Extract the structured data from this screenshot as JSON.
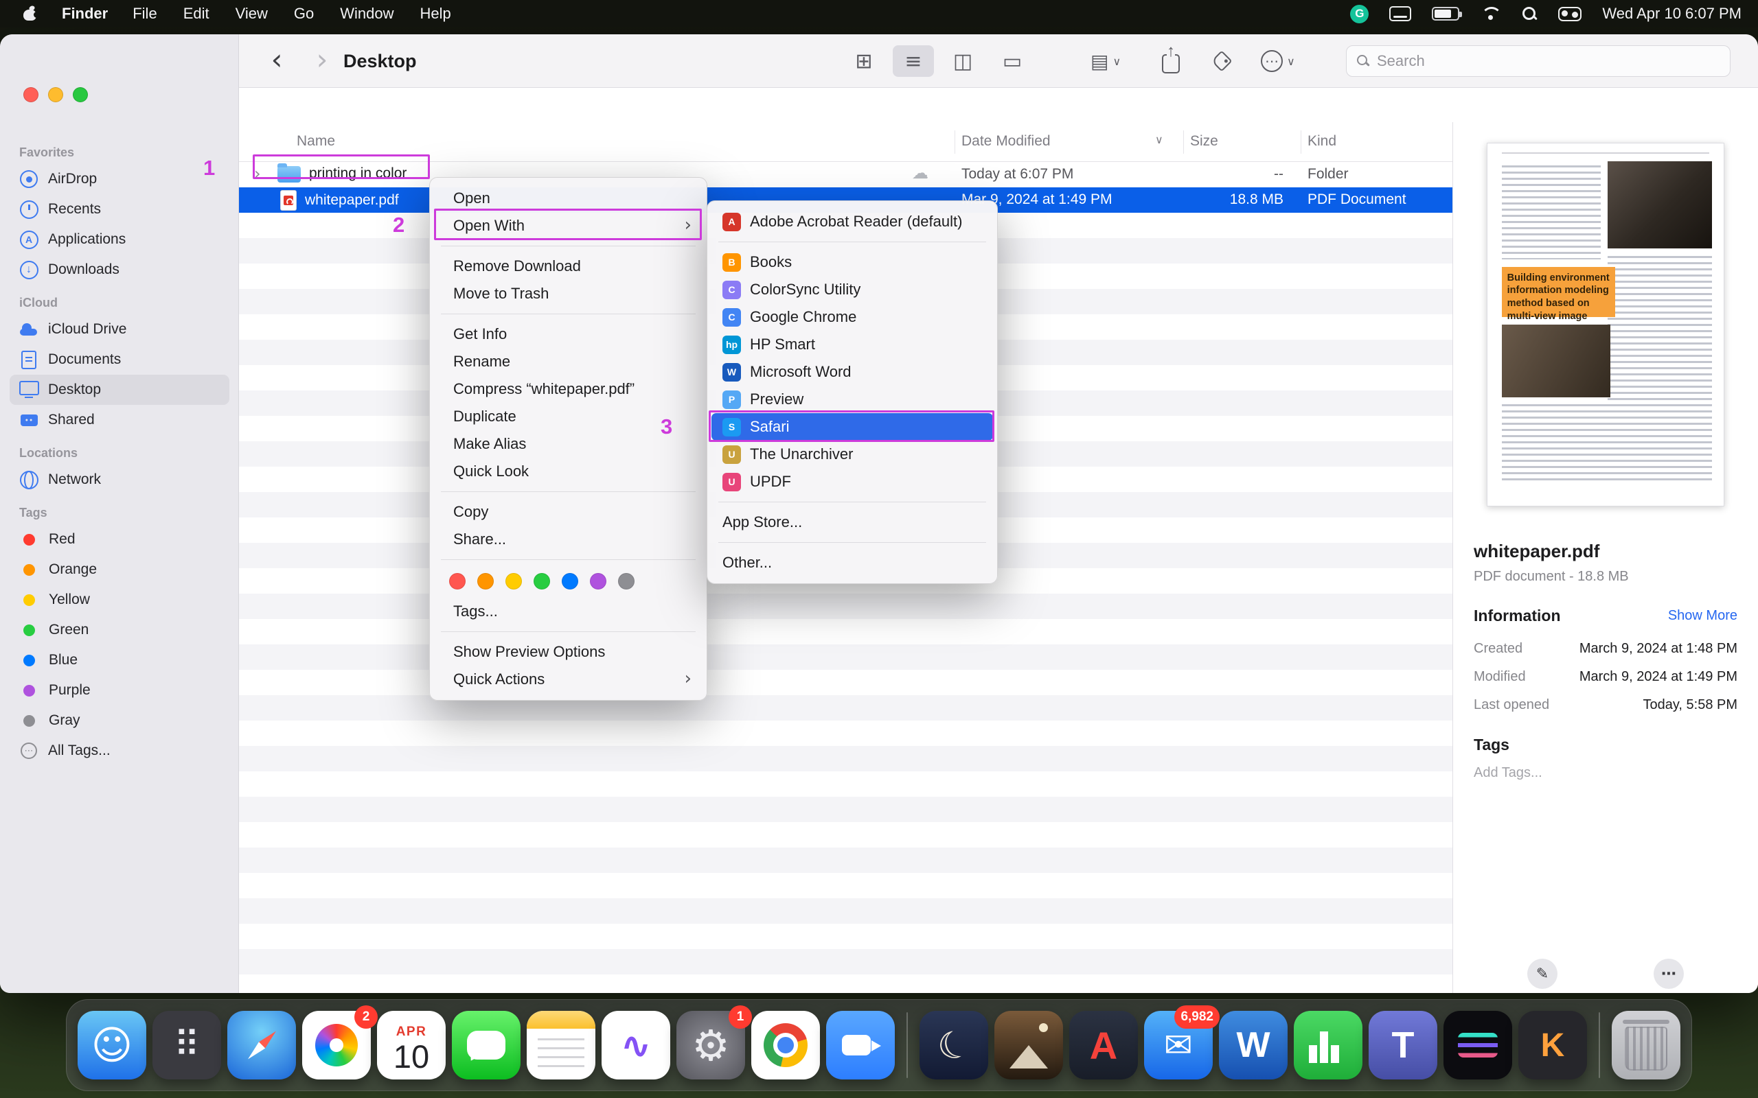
{
  "menu_bar": {
    "app_name": "Finder",
    "menus": [
      "File",
      "Edit",
      "View",
      "Go",
      "Window",
      "Help"
    ],
    "status": {
      "datetime": "Wed Apr 10  6:07 PM",
      "grammarly_glyph": "G"
    }
  },
  "toolbar": {
    "title": "Desktop",
    "search_placeholder": "Search"
  },
  "sidebar": {
    "favorites": {
      "title": "Favorites",
      "items": [
        {
          "label": "AirDrop",
          "icon": "airdrop-icon"
        },
        {
          "label": "Recents",
          "icon": "recents-icon"
        },
        {
          "label": "Applications",
          "icon": "applications-icon"
        },
        {
          "label": "Downloads",
          "icon": "downloads-icon"
        }
      ]
    },
    "icloud": {
      "title": "iCloud",
      "items": [
        {
          "label": "iCloud Drive",
          "icon": "icloud-drive-icon"
        },
        {
          "label": "Documents",
          "icon": "documents-icon"
        },
        {
          "label": "Desktop",
          "icon": "desktop-icon",
          "state": "selected"
        },
        {
          "label": "Shared",
          "icon": "shared-icon"
        }
      ]
    },
    "locations": {
      "title": "Locations",
      "items": [
        {
          "label": "Network",
          "icon": "network-icon"
        }
      ]
    },
    "tags": {
      "title": "Tags",
      "items": [
        {
          "label": "Red",
          "icon": "tag-dot",
          "color": "#ff3b30"
        },
        {
          "label": "Orange",
          "icon": "tag-dot",
          "color": "#ff9500"
        },
        {
          "label": "Yellow",
          "icon": "tag-dot",
          "color": "#ffcc00"
        },
        {
          "label": "Green",
          "icon": "tag-dot",
          "color": "#28cd41"
        },
        {
          "label": "Blue",
          "icon": "tag-dot",
          "color": "#007aff"
        },
        {
          "label": "Purple",
          "icon": "tag-dot",
          "color": "#af52de"
        },
        {
          "label": "Gray",
          "icon": "tag-dot",
          "color": "#8e8e93"
        },
        {
          "label": "All Tags...",
          "icon": "all-tags-icon"
        }
      ]
    }
  },
  "file_list": {
    "columns": [
      "Name",
      "Date Modified",
      "Size",
      "Kind"
    ],
    "rows": [
      {
        "name": "printing in color",
        "date_modified": "Today at 6:07 PM",
        "size": "--",
        "kind": "Folder",
        "icon": "folder-icon",
        "expandable": true,
        "has_cloud": true
      },
      {
        "name": "whitepaper.pdf",
        "date_modified": "Mar 9, 2024 at 1:49 PM",
        "size": "18.8 MB",
        "kind": "PDF Document",
        "icon": "pdf-icon",
        "state": "selected",
        "annotated": true
      }
    ]
  },
  "context_menu": {
    "group1": [
      {
        "label": "Open"
      },
      {
        "label": "Open With",
        "has_submenu": true,
        "annotated": true
      }
    ],
    "group2": [
      {
        "label": "Remove Download"
      },
      {
        "label": "Move to Trash"
      }
    ],
    "group3": [
      {
        "label": "Get Info"
      },
      {
        "label": "Rename"
      },
      {
        "label": "Compress “whitepaper.pdf”"
      },
      {
        "label": "Duplicate"
      },
      {
        "label": "Make Alias"
      },
      {
        "label": "Quick Look"
      }
    ],
    "group4": [
      {
        "label": "Copy"
      },
      {
        "label": "Share..."
      }
    ],
    "tag_colors": [
      {
        "name": "red-tag-dot",
        "color": "#ff564f"
      },
      {
        "name": "orange-tag-dot",
        "color": "#ff9500"
      },
      {
        "name": "yellow-tag-dot",
        "color": "#ffcc00"
      },
      {
        "name": "green-tag-dot",
        "color": "#28cd41"
      },
      {
        "name": "blue-tag-dot",
        "color": "#007aff"
      },
      {
        "name": "purple-tag-dot",
        "color": "#af52de"
      },
      {
        "name": "gray-tag-dot",
        "color": "#8e8e93"
      }
    ],
    "tags_item": "Tags...",
    "group5": [
      {
        "label": "Show Preview Options"
      },
      {
        "label": "Quick Actions",
        "has_submenu": true
      }
    ]
  },
  "open_with_submenu": {
    "group1": [
      {
        "label": "Adobe Acrobat Reader (default)",
        "icon_name": "acrobat-icon",
        "icon_color": "#d6362a",
        "icon_glyph": "A"
      }
    ],
    "group2": [
      {
        "label": "Books",
        "icon_name": "books-icon",
        "icon_color": "#ff9500",
        "icon_glyph": "B"
      },
      {
        "label": "ColorSync Utility",
        "icon_name": "colorsync-icon",
        "icon_color": "#8b7bf5",
        "icon_glyph": "C"
      },
      {
        "label": "Google Chrome",
        "icon_name": "chrome-icon",
        "icon_color": "#4285f4",
        "icon_glyph": "C"
      },
      {
        "label": "HP Smart",
        "icon_name": "hp-smart-icon",
        "icon_color": "#0096d6",
        "icon_glyph": "hp"
      },
      {
        "label": "Microsoft Word",
        "icon_name": "word-icon",
        "icon_color": "#185abd",
        "icon_glyph": "W"
      },
      {
        "label": "Preview",
        "icon_name": "preview-icon",
        "icon_color": "#55a8f5",
        "icon_glyph": "P"
      },
      {
        "label": "Safari",
        "icon_name": "safari-icon",
        "icon_color": "#1b9af2",
        "icon_glyph": "S",
        "state": "highlighted",
        "annotated": true
      },
      {
        "label": "The Unarchiver",
        "icon_name": "unarchiver-icon",
        "icon_color": "#c9a23e",
        "icon_glyph": "U"
      },
      {
        "label": "UPDF",
        "icon_name": "updf-icon",
        "icon_color": "#e8457a",
        "icon_glyph": "U"
      }
    ],
    "group3": [
      {
        "label": "App Store...",
        "no_icon": true
      }
    ],
    "group4": [
      {
        "label": "Other...",
        "no_icon": true
      }
    ]
  },
  "preview": {
    "thumbnail_title": "Building environment information modeling method based on multi-view image",
    "filename": "whitepaper.pdf",
    "file_info": "PDF document - 18.8 MB",
    "information_title": "Information",
    "show_more": "Show More",
    "fields": [
      {
        "label": "Created",
        "value": "March 9, 2024 at 1:48 PM"
      },
      {
        "label": "Modified",
        "value": "March 9, 2024 at 1:49 PM"
      },
      {
        "label": "Last opened",
        "value": "Today, 5:58 PM"
      }
    ],
    "tags_title": "Tags",
    "add_tags": "Add Tags...",
    "actions": [
      {
        "label": "Markup",
        "icon": "markup-icon"
      },
      {
        "label": "More...",
        "icon": "more-icon"
      }
    ]
  },
  "annotations": {
    "color": "#cd3bdb",
    "items": [
      {
        "number": "1",
        "target": "whitepaper-pdf-row"
      },
      {
        "number": "2",
        "target": "open-with-menu-item"
      },
      {
        "number": "3",
        "target": "safari-submenu-item"
      }
    ]
  },
  "dock": {
    "items": [
      {
        "app": "finder",
        "name": "finder-dock-icon"
      },
      {
        "app": "launchpad",
        "name": "launchpad-dock-icon"
      },
      {
        "app": "safari",
        "name": "safari-dock-icon"
      },
      {
        "app": "photos",
        "name": "photos-dock-icon",
        "badge": "2"
      },
      {
        "app": "calendar",
        "name": "calendar-dock-icon",
        "cal_month": "APR",
        "cal_day": "10"
      },
      {
        "app": "messages",
        "name": "messages-dock-icon"
      },
      {
        "app": "notes",
        "name": "notes-dock-icon"
      },
      {
        "app": "freeform",
        "name": "freeform-dock-icon"
      },
      {
        "app": "settings",
        "name": "system-settings-dock-icon",
        "badge": "1"
      },
      {
        "app": "chrome",
        "name": "chrome-dock-icon"
      },
      {
        "app": "zoom",
        "name": "zoom-dock-icon"
      },
      {
        "type": "separator",
        "app": "sep",
        "name": "dock-separator"
      },
      {
        "app": "moon",
        "name": "moon-app-dock-icon"
      },
      {
        "app": "pictures",
        "name": "image-viewer-dock-icon"
      },
      {
        "app": "acrobat",
        "name": "acrobat-dock-icon"
      },
      {
        "app": "mail",
        "name": "mail-dock-icon",
        "badge": "6,982"
      },
      {
        "app": "word",
        "name": "word-dock-icon"
      },
      {
        "app": "numbers",
        "name": "numbers-dock-icon"
      },
      {
        "app": "teams",
        "name": "teams-dock-icon"
      },
      {
        "app": "wave",
        "name": "wave-app-dock-icon"
      },
      {
        "app": "keys",
        "name": "key-app-dock-icon"
      },
      {
        "type": "separator",
        "app": "sep",
        "name": "dock-separator"
      },
      {
        "app": "trash",
        "name": "trash-dock-icon"
      }
    ]
  },
  "colors": {
    "selection_blue": "#0a5fe8",
    "menu_highlight_blue": "#2f6ae8",
    "annotation_purple": "#cd3bdb",
    "badge_red": "#ff3b30",
    "sidebar_icon_blue": "#3f7bf0"
  }
}
